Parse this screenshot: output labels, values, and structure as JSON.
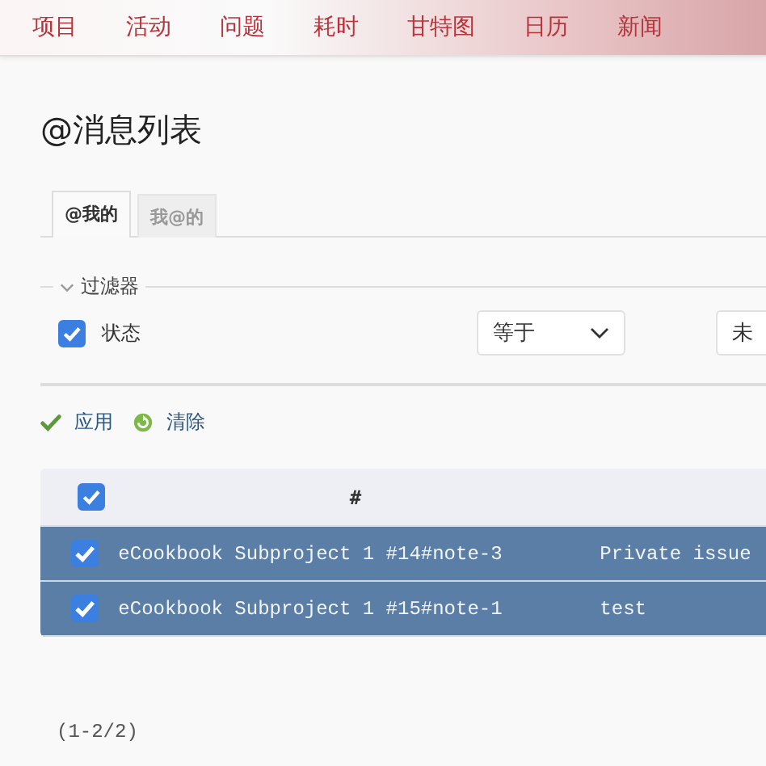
{
  "menu": [
    {
      "label": "项目"
    },
    {
      "label": "活动"
    },
    {
      "label": "问题"
    },
    {
      "label": "耗时"
    },
    {
      "label": "甘特图"
    },
    {
      "label": "日历"
    },
    {
      "label": "新闻"
    }
  ],
  "title": "@消息列表",
  "tabs": [
    {
      "label": "@我的",
      "selected": true
    },
    {
      "label": "我@的",
      "selected": false
    }
  ],
  "filters": {
    "legend": "过滤器",
    "expanded": true,
    "rows": [
      {
        "label": "状态",
        "checked": true,
        "operator": "等于",
        "value": "未"
      }
    ]
  },
  "actions": [
    {
      "kind": "apply",
      "label": "应用"
    },
    {
      "kind": "clear",
      "label": "清除"
    }
  ],
  "table": {
    "all_checked": true,
    "columns": [
      "#"
    ],
    "rows": [
      {
        "selected": true,
        "column_1": "eCookbook Subproject 1 #14#note-3",
        "column_2": "Private issue"
      },
      {
        "selected": true,
        "column_1": "eCookbook Subproject 1 #15#note-1",
        "column_2": "test"
      }
    ]
  },
  "pagination": "(1-2/2)"
}
